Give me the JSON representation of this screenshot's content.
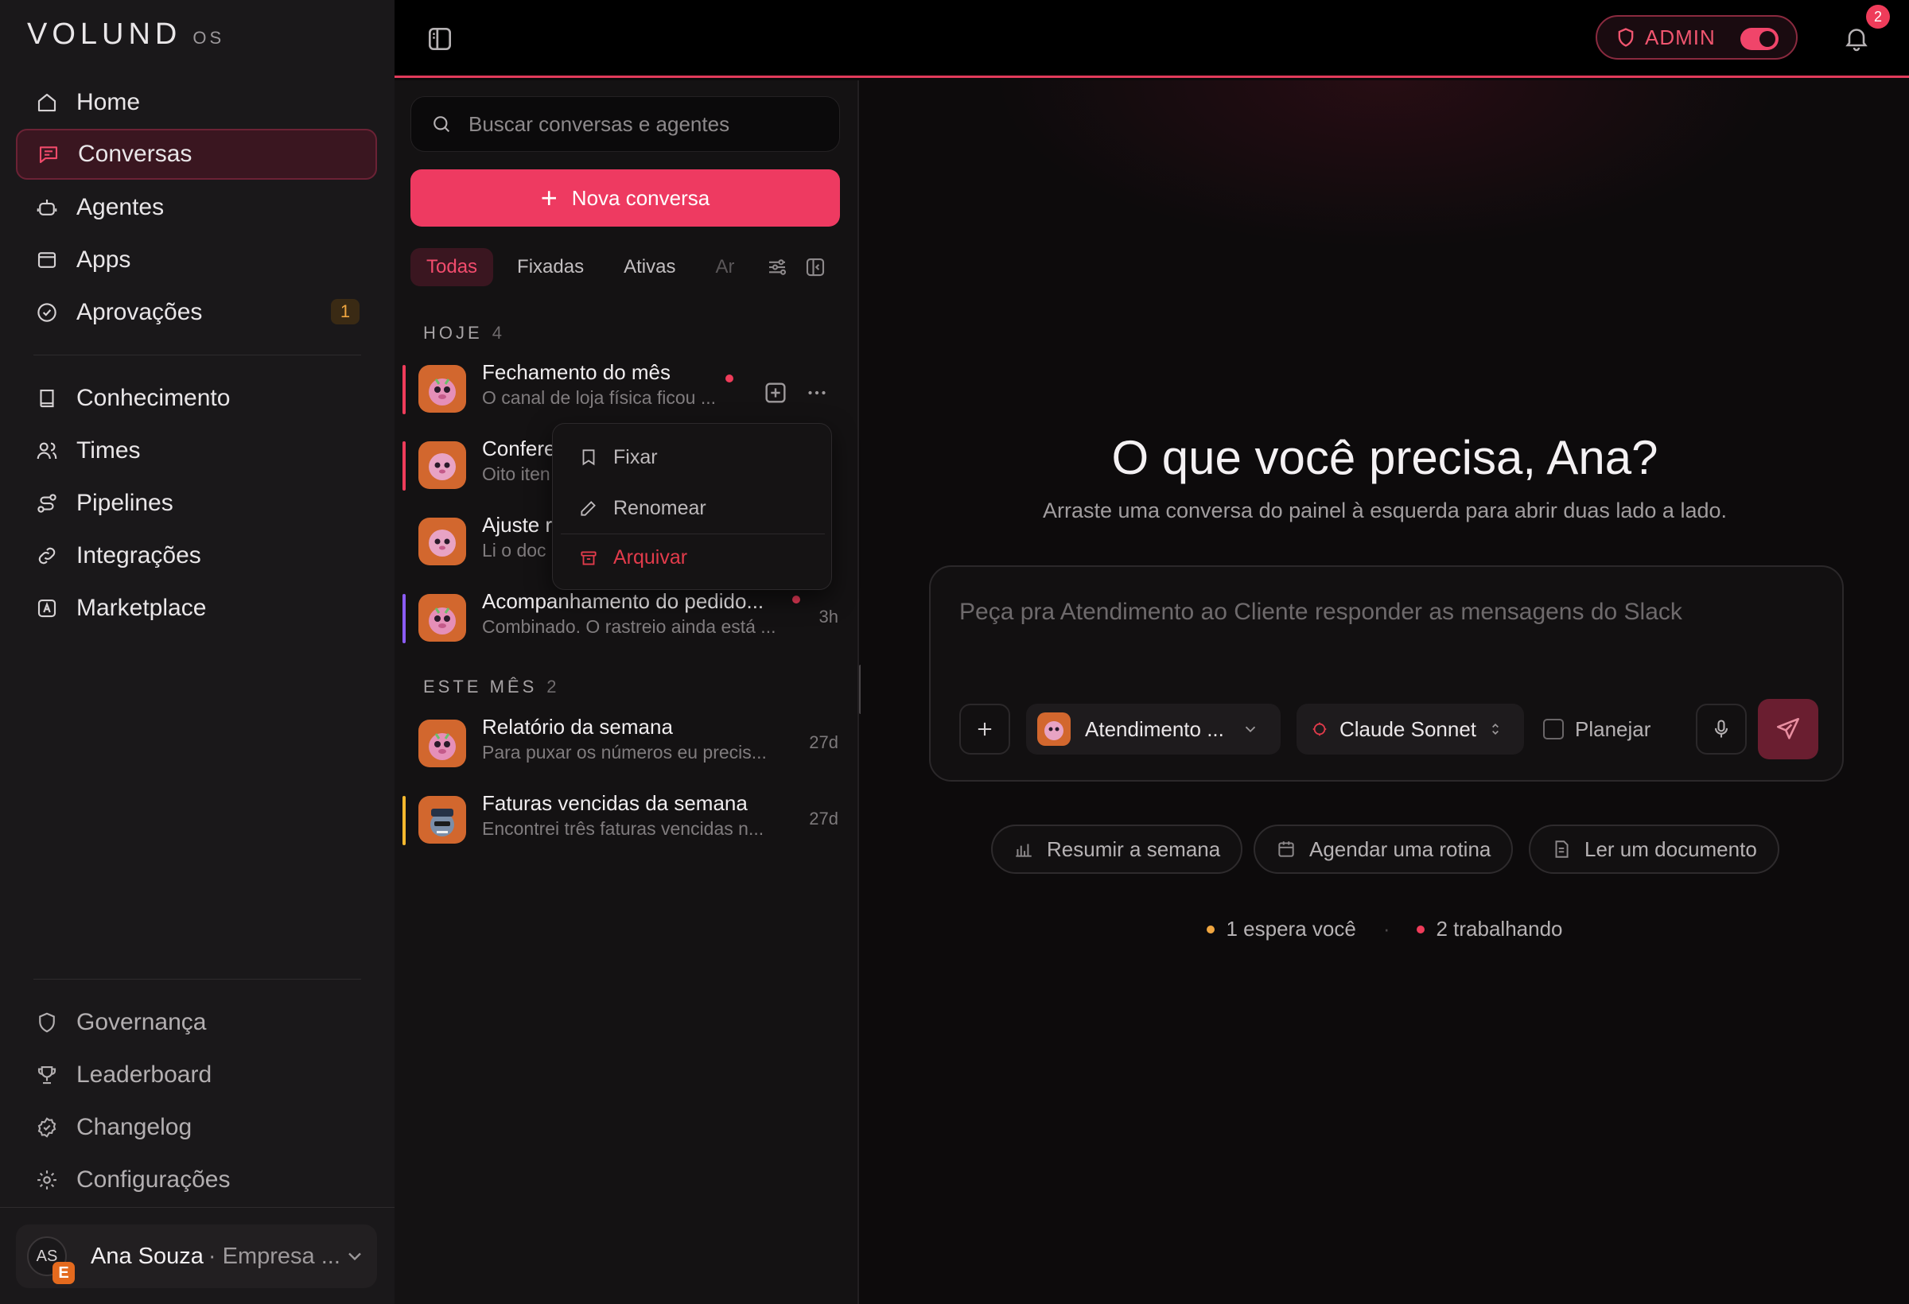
{
  "brand": {
    "wordmark": "VOLUND",
    "suffix": "OS"
  },
  "sidebar": {
    "items": [
      {
        "label": "Home",
        "icon": "home-icon",
        "active": false
      },
      {
        "label": "Conversas",
        "icon": "chat-icon",
        "active": true
      },
      {
        "label": "Agentes",
        "icon": "robot-icon",
        "active": false
      },
      {
        "label": "Apps",
        "icon": "app-window-icon",
        "active": false
      },
      {
        "label": "Aprovações",
        "icon": "check-circle-icon",
        "active": false,
        "badge": "1"
      },
      {
        "label": "Conhecimento",
        "icon": "book-icon",
        "active": false
      },
      {
        "label": "Times",
        "icon": "users-icon",
        "active": false
      },
      {
        "label": "Pipelines",
        "icon": "route-icon",
        "active": false
      },
      {
        "label": "Integrações",
        "icon": "link-icon",
        "active": false
      },
      {
        "label": "Marketplace",
        "icon": "store-icon",
        "active": false
      }
    ],
    "bottom_items": [
      {
        "label": "Governança",
        "icon": "shield-icon"
      },
      {
        "label": "Leaderboard",
        "icon": "trophy-icon"
      },
      {
        "label": "Changelog",
        "icon": "badge-icon"
      },
      {
        "label": "Configurações",
        "icon": "gear-icon"
      }
    ],
    "user": {
      "initials": "AS",
      "org_initial": "E",
      "name": "Ana Souza",
      "org": "· Empresa ..."
    }
  },
  "topbar": {
    "admin_label": "ADMIN",
    "admin_on": true,
    "notifications": "2"
  },
  "list": {
    "search_placeholder": "Buscar conversas e agentes",
    "new_label": "Nova conversa",
    "tabs": [
      "Todas",
      "Fixadas",
      "Ativas",
      "Arq"
    ],
    "active_tab": "Todas",
    "sections": [
      {
        "title": "HOJE",
        "count": "4"
      },
      {
        "title": "ESTE MÊS",
        "count": "2"
      }
    ],
    "conversations": [
      {
        "title": "Fechamento do mês",
        "sub": "O canal de loja física ficou ...",
        "time": "",
        "unread": true,
        "accent": "#ef3c5a",
        "avatar": "pink"
      },
      {
        "title": "Confere",
        "sub": "Oito iten",
        "time": "",
        "unread": false,
        "accent": "#ef3c5a",
        "avatar": "pink"
      },
      {
        "title": "Ajuste r",
        "sub": "Li o doc",
        "time": "",
        "unread": false,
        "accent": "",
        "avatar": "pink"
      },
      {
        "title": "Acompanhamento do pedido...",
        "sub": "Combinado. O rastreio ainda está ...",
        "time": "3h",
        "unread": true,
        "accent": "#8b5cf6",
        "avatar": "pink"
      },
      {
        "title": "Relatório da semana",
        "sub": "Para puxar os números eu precis...",
        "time": "27d",
        "unread": false,
        "accent": "",
        "avatar": "pink"
      },
      {
        "title": "Faturas vencidas da semana",
        "sub": "Encontrei três faturas vencidas n...",
        "time": "27d",
        "unread": false,
        "accent": "#f5b82e",
        "avatar": "police"
      }
    ],
    "context_menu": [
      {
        "label": "Fixar",
        "icon": "bookmark-icon"
      },
      {
        "label": "Renomear",
        "icon": "pencil-icon"
      },
      {
        "label": "Arquivar",
        "icon": "archive-icon",
        "danger": true
      }
    ]
  },
  "main": {
    "title": "O que você precisa, Ana?",
    "subtitle": "Arraste uma conversa do painel à esquerda para abrir duas lado a lado.",
    "composer": {
      "placeholder": "Peça pra Atendimento ao Cliente responder as mensagens do Slack",
      "agent": "Atendimento ...",
      "model": "Claude Sonnet",
      "plan_label": "Planejar",
      "plan_checked": false
    },
    "chips": [
      "Resumir a semana",
      "Agendar uma rotina",
      "Ler um documento"
    ],
    "status": [
      {
        "text": "1 espera você",
        "color": "#f0a640"
      },
      {
        "text": "2 trabalhando",
        "color": "#ef3c5a"
      }
    ]
  }
}
